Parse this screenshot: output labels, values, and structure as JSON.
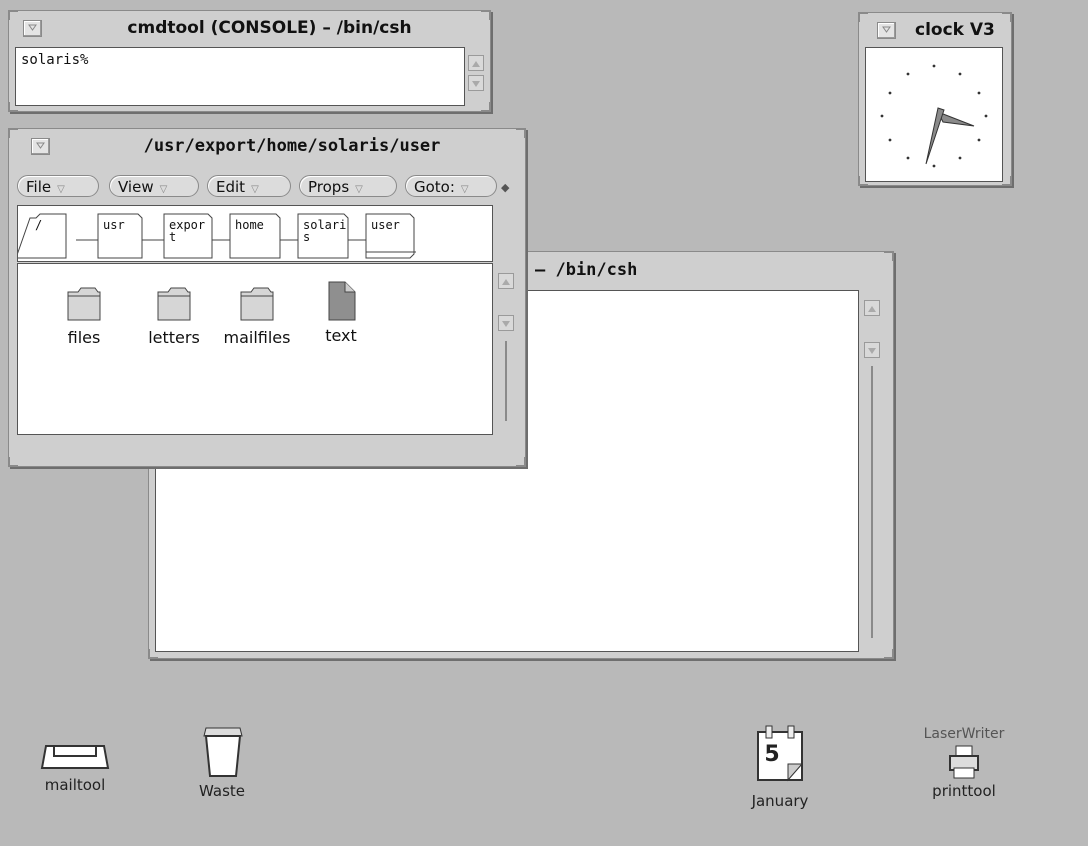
{
  "console": {
    "title": "cmdtool (CONSOLE) – /bin/csh",
    "prompt": "solaris%"
  },
  "clock": {
    "title": "clock V3"
  },
  "shell_bg": {
    "title": "– /bin/csh"
  },
  "filemgr": {
    "title": "/usr/export/home/solaris/user",
    "menus": [
      "File",
      "View",
      "Edit",
      "Props",
      "Goto:"
    ],
    "path": [
      "/",
      "usr",
      "expor t",
      "home",
      "solari s",
      "user"
    ],
    "files": [
      {
        "name": "files",
        "kind": "folder"
      },
      {
        "name": "letters",
        "kind": "folder"
      },
      {
        "name": "mailfiles",
        "kind": "folder"
      },
      {
        "name": "text",
        "kind": "document"
      }
    ]
  },
  "desktop": {
    "mailtool": "mailtool",
    "waste": "Waste",
    "calendar_day": "5",
    "calendar_month": "January",
    "printer_name": "LaserWriter",
    "printtool": "printtool"
  }
}
